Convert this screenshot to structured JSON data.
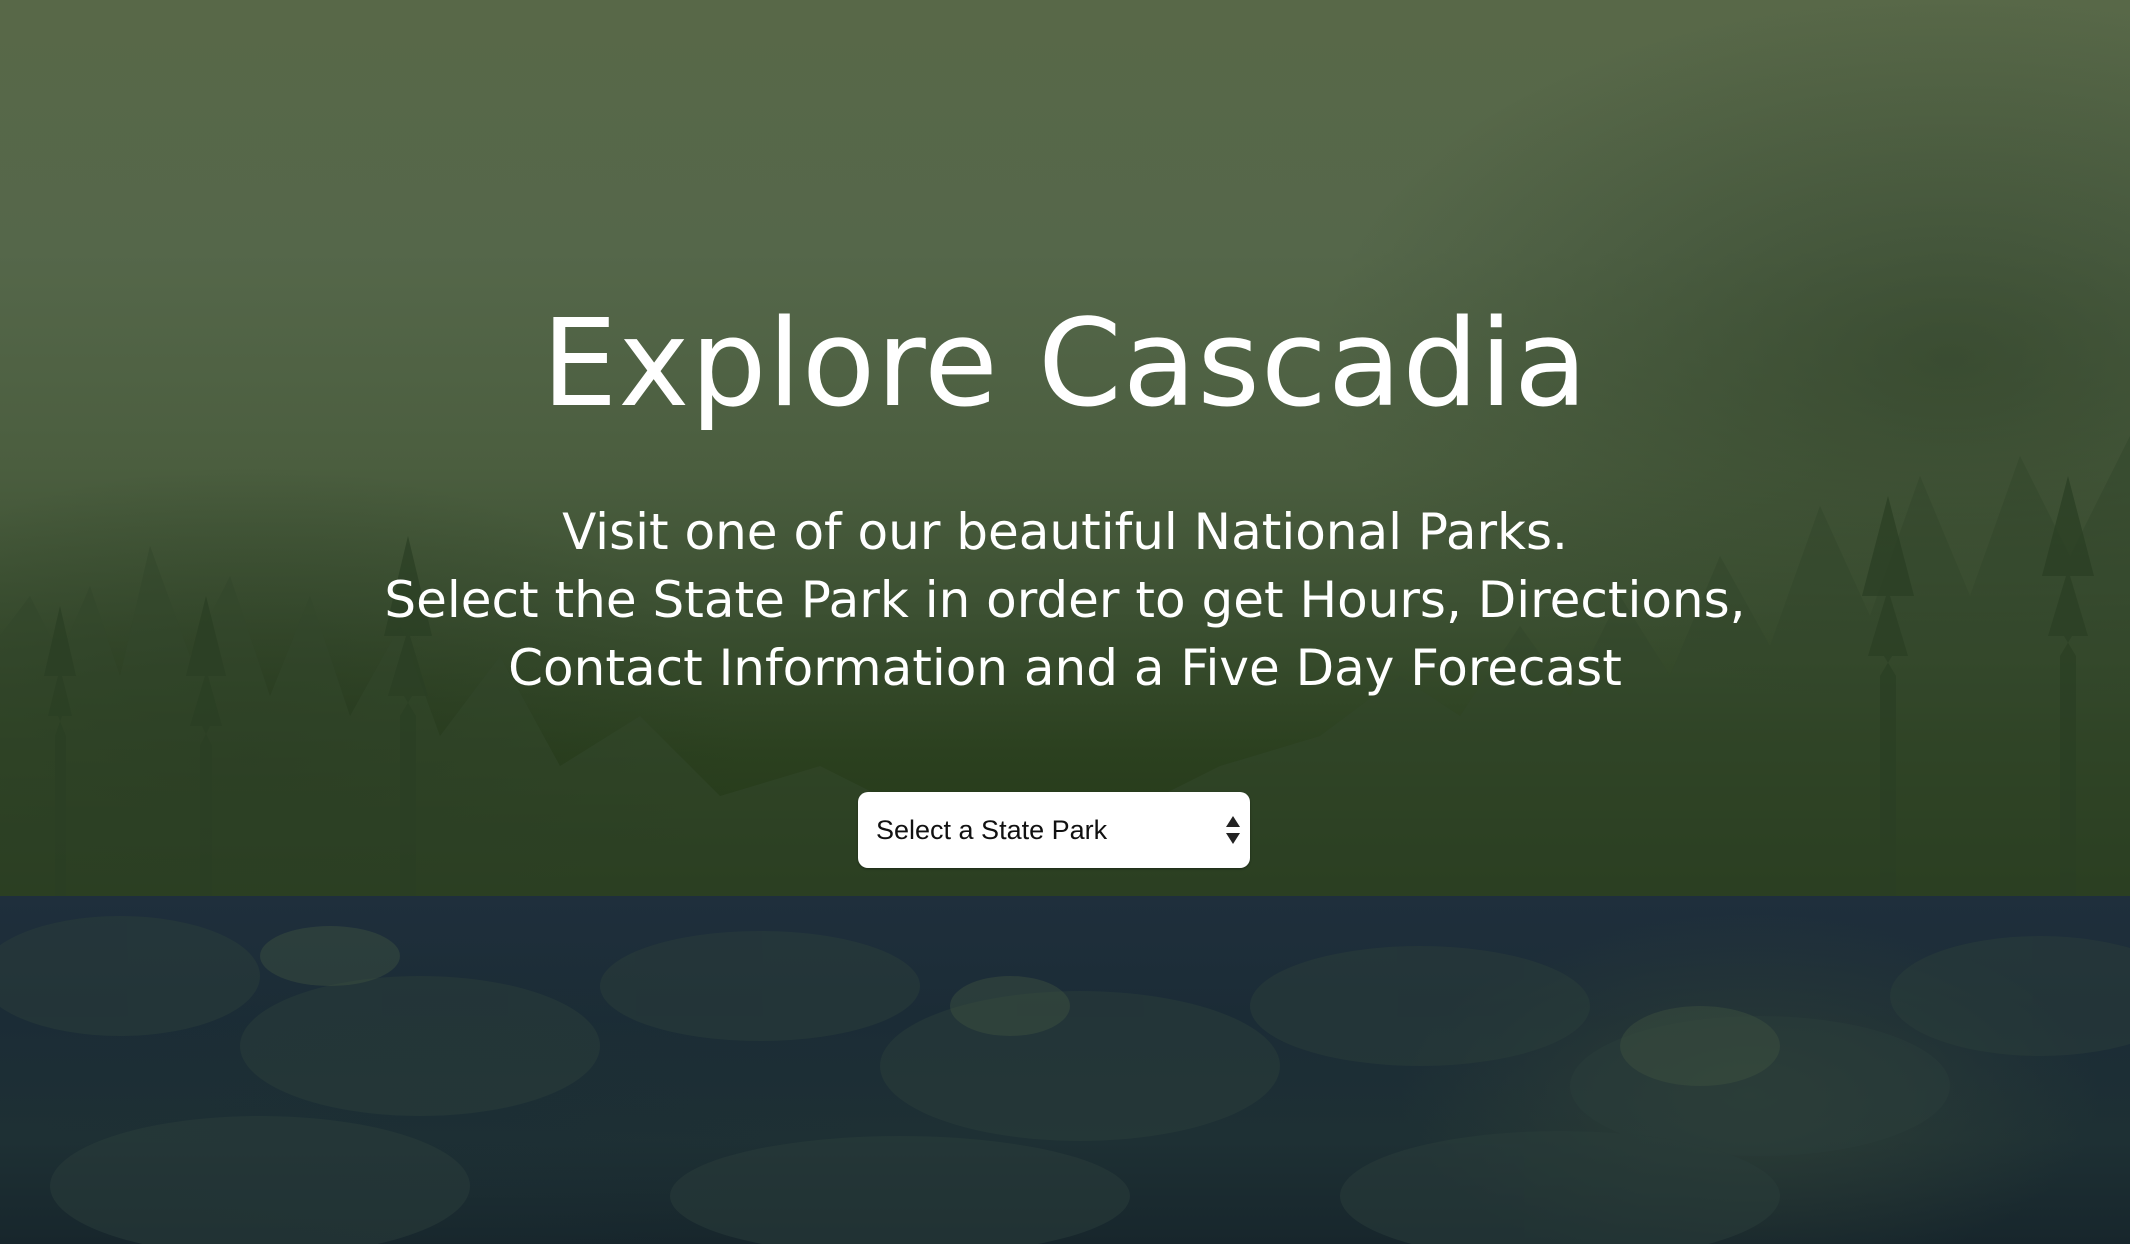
{
  "hero": {
    "title": "Explore Cascadia",
    "subtitle_lines": [
      "Visit one of our beautiful National Parks.",
      "Select the State Park in order to get Hours, Directions,",
      "Contact Information and a Five Day Forecast"
    ]
  },
  "park_select": {
    "selected_label": "Select a State Park",
    "icon": "updown-arrows-icon"
  },
  "colors": {
    "hero_top": "#586848",
    "hero_bottom": "#223617",
    "lower_band": "#1b2c36",
    "text": "#ffffff",
    "select_background": "#ffffff",
    "select_text": "#111111"
  }
}
